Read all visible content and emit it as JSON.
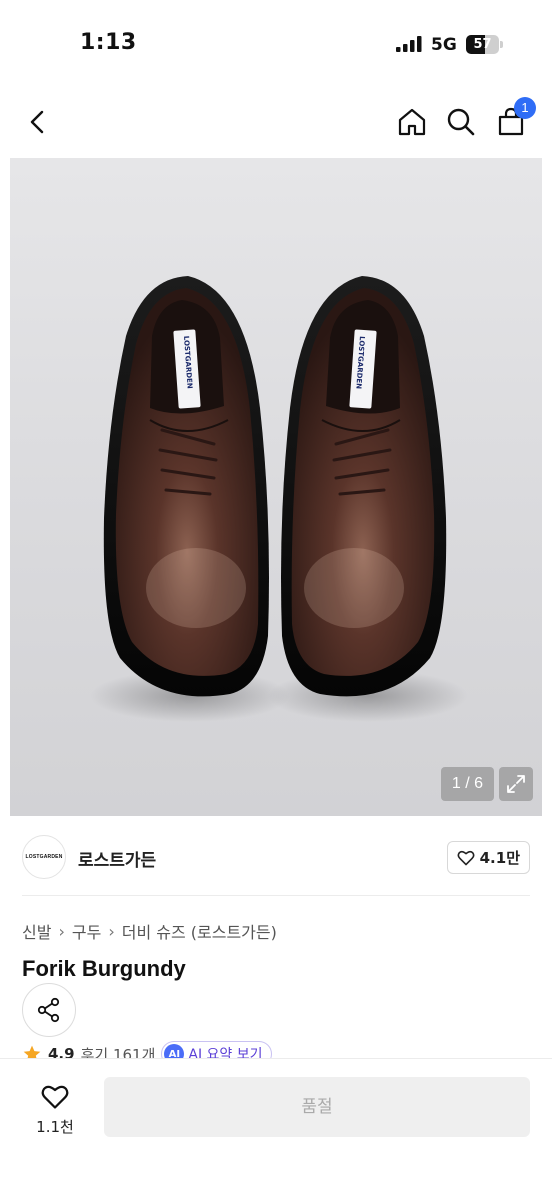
{
  "status_bar": {
    "time": "1:13",
    "network": "5G",
    "battery_level": "57",
    "battery_fraction": 0.57
  },
  "nav": {
    "cart_badge": "1",
    "icons": [
      "chevron-left-icon",
      "home-icon",
      "search-icon",
      "shopping-bag-icon"
    ]
  },
  "gallery": {
    "counter": "1 / 6",
    "tongue_label": "LOSTGARDEN",
    "expand_icon": "expand-icon"
  },
  "brand": {
    "logo_text": "LOSTGARDEN",
    "name": "로스트가든",
    "likes": "4.1만"
  },
  "breadcrumb": [
    "신발",
    "구두",
    "더비 슈즈 (로스트가든)"
  ],
  "product": {
    "title": "Forik Burgundy",
    "rating": "4.9",
    "reviews": "후기 161개",
    "ai_badge": "AI",
    "ai_summary": "AI 요약 보기"
  },
  "bottom_bar": {
    "wish_count": "1.1천",
    "soldout_label": "품절"
  },
  "colors": {
    "accent": "#2f6df6",
    "ai_purple": "#5a3fd6",
    "star": "#f5a623",
    "shoe_leather": "#3b221c"
  }
}
